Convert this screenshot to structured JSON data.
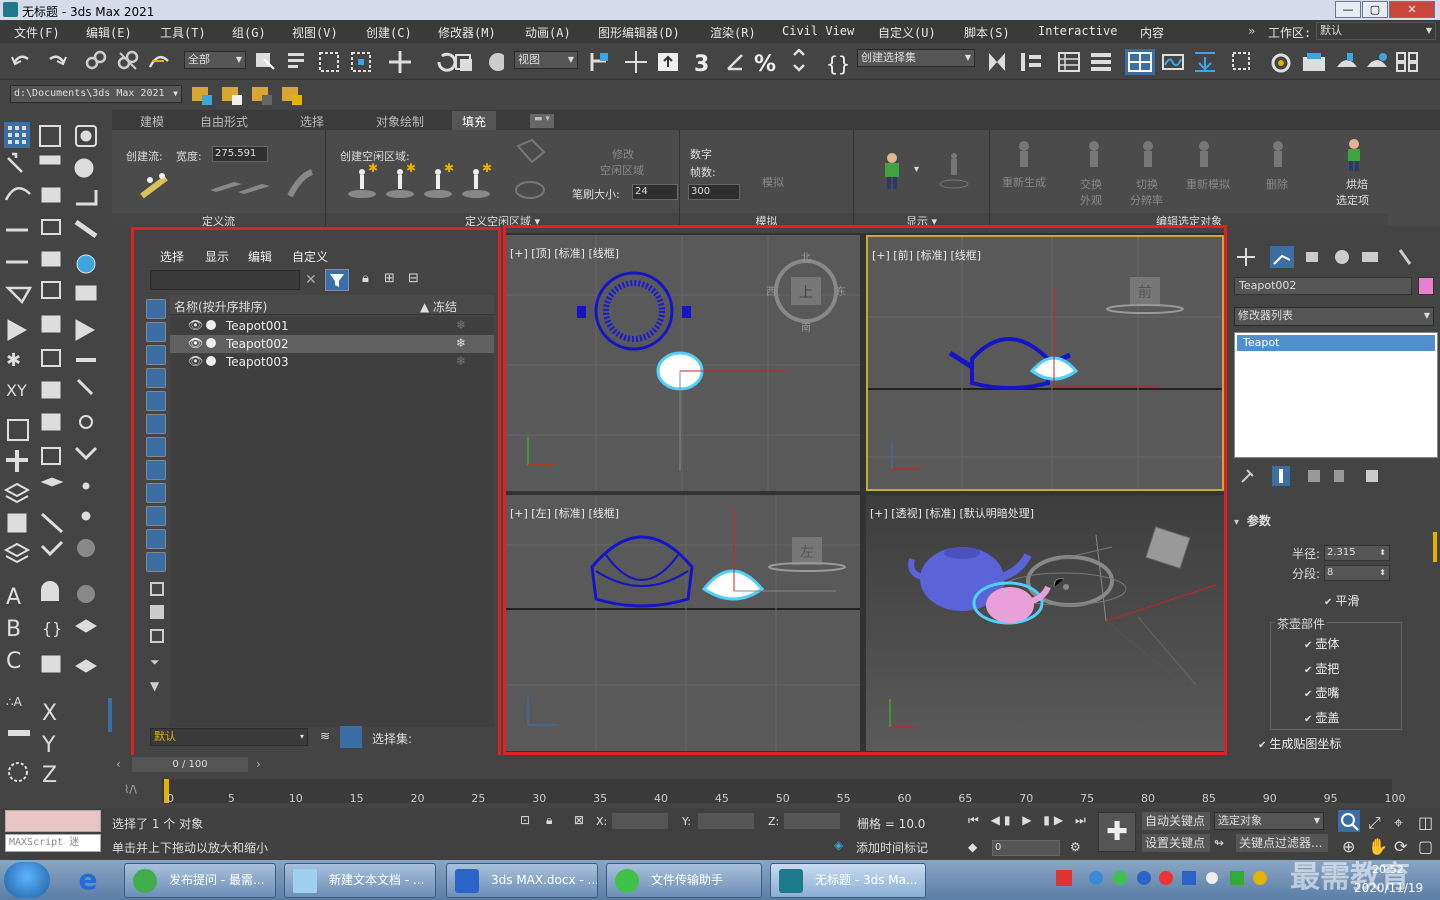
{
  "window": {
    "title": "无标题 - 3ds Max 2021",
    "btn_min": "—",
    "btn_max": "▢",
    "btn_close": "✕"
  },
  "menubar": [
    "文件(F)",
    "编辑(E)",
    "工具(T)",
    "组(G)",
    "视图(V)",
    "创建(C)",
    "修改器(M)",
    "动画(A)",
    "图形编辑器(D)",
    "渲染(R)",
    "Civil View",
    "自定义(U)",
    "脚本(S)",
    "Interactive",
    "内容"
  ],
  "workspace": {
    "label": "工作区:",
    "value": "默认"
  },
  "toolbar": {
    "filter_all": "全部",
    "ref_coord": "视图",
    "selection_set": "创建选择集"
  },
  "path": "d:\\Documents\\3ds Max 2021",
  "ribbon": {
    "tabs": [
      "建模",
      "自由形式",
      "选择",
      "对象绘制",
      "填充"
    ],
    "active_tab": "填充",
    "flow": {
      "create_flow": "创建流:",
      "width_label": "宽度:",
      "width_value": "275.591",
      "footer": "定义流"
    },
    "idle": {
      "label": "创建空闲区域:",
      "modify": "修改",
      "modify2": "空闲区域",
      "brush_label": "笔刷大小:",
      "brush_value": "24",
      "footer": "定义空闲区域"
    },
    "sim": {
      "num": "数字",
      "frames": "帧数:",
      "frames_value": "300",
      "simulate": "模拟",
      "footer": "模拟"
    },
    "display": {
      "footer": "显示"
    },
    "edit": {
      "regen": "重新生成",
      "swap1": "交换",
      "swap2": "外观",
      "switch1": "切换",
      "switch2": "分辨率",
      "resim": "重新模拟",
      "delete": "删除",
      "bake1": "烘焙",
      "bake2": "选定项",
      "footer": "编辑选定对象"
    }
  },
  "explorer": {
    "menu": [
      "选择",
      "显示",
      "编辑",
      "自定义"
    ],
    "col_name": "名称(按升序排序)",
    "col_freeze": "▲ 冻结",
    "rows": [
      "Teapot001",
      "Teapot002",
      "Teapot003"
    ],
    "selected_row": 1,
    "layer": "默认",
    "selection_set_label": "选择集:"
  },
  "viewports": {
    "top": "[+] [顶] [标准] [线框]",
    "front": "[+] [前] [标准] [线框]",
    "left": "[+] [左] [标准] [线框]",
    "persp": "[+] [透视] [标准] [默认明暗处理]",
    "cube_top": "上",
    "cube_front": "前",
    "cube_left": "左",
    "compass_n": "北",
    "compass_s": "南",
    "compass_w": "西",
    "compass_e": "东"
  },
  "command_panel": {
    "object_name": "Teapot002",
    "object_color": "#e87fd0",
    "modifier_list": "修改器列表",
    "stack_item": "Teapot",
    "rollout": "参数",
    "radius_label": "半径:",
    "radius_value": "2.315",
    "segments_label": "分段:",
    "segments_value": "8",
    "smooth": "平滑",
    "parts_label": "茶壶部件",
    "parts": [
      "壶体",
      "壶把",
      "壶嘴",
      "壶盖"
    ],
    "gen_map": "生成贴图坐标"
  },
  "timeline": {
    "frame": "0 / 100",
    "ticks": [
      "0",
      "5",
      "10",
      "15",
      "20",
      "25",
      "30",
      "35",
      "40",
      "45",
      "50",
      "55",
      "60",
      "65",
      "70",
      "75",
      "80",
      "85",
      "90",
      "95",
      "100"
    ]
  },
  "status": {
    "maxscript": "MAXScript 迷",
    "selected": "选择了 1 个 对象",
    "hint": "单击并上下拖动以放大和缩小",
    "x": "X:",
    "y": "Y:",
    "z": "Z:",
    "grid": "栅格 = 10.0",
    "add_time_tag": "添加时间标记",
    "auto_key": "自动关键点",
    "selected_obj": "选定对象",
    "set_key": "设置关键点",
    "key_filter": "关键点过滤器...",
    "frame_value": "0"
  },
  "taskbar": {
    "tasks": [
      "发布提问 - 最需...",
      "新建文本文档 - ...",
      "3ds MAX.docx - ...",
      "文件传输助手",
      "无标题 - 3ds Ma..."
    ],
    "time": "20:52",
    "date": "2020/11/19",
    "watermark": "最需教育"
  }
}
